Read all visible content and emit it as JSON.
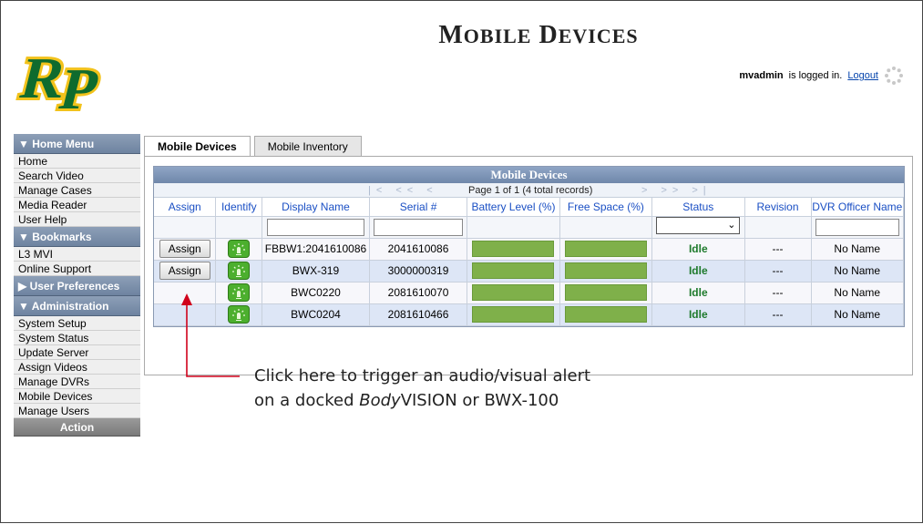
{
  "header": {
    "title_first": "M",
    "title_first_rest": "OBILE",
    "title_second": "D",
    "title_second_rest": "EVICES",
    "user": "mvadmin",
    "logged_in_text": "is logged in.",
    "logout_label": "Logout"
  },
  "sidebar": {
    "sections": [
      {
        "header": "▼ Home Menu",
        "items": [
          "Home",
          "Search Video",
          "Manage Cases",
          "Media Reader",
          "User Help"
        ]
      },
      {
        "header": "▼ Bookmarks",
        "items": [
          "L3 MVI",
          "Online Support"
        ]
      },
      {
        "header": "▶ User Preferences",
        "items": []
      },
      {
        "header": "▼ Administration",
        "items": [
          "System Setup",
          "System Status",
          "Update Server",
          "Assign Videos",
          "Manage DVRs",
          "Mobile Devices",
          "Manage Users"
        ]
      }
    ],
    "action_label": "Action"
  },
  "tabs": [
    {
      "label": "Mobile Devices",
      "active": true
    },
    {
      "label": "Mobile Inventory",
      "active": false
    }
  ],
  "grid": {
    "title": "Mobile Devices",
    "pager_info": "Page 1 of 1 (4 total records)",
    "nav_left": "|< << <",
    "nav_right": "> >> >|",
    "columns": [
      "Assign",
      "Identify",
      "Display Name",
      "Serial #",
      "Battery Level (%)",
      "Free Space (%)",
      "Status",
      "Revision",
      "DVR Officer Name"
    ],
    "rows": [
      {
        "assign": "Assign",
        "display_name": "FBBW1:2041610086",
        "serial": "2041610086",
        "battery": 100,
        "free_space": 100,
        "status": "Idle",
        "revision": "---",
        "officer": "No Name"
      },
      {
        "assign": "Assign",
        "display_name": "BWX-319",
        "serial": "3000000319",
        "battery": 100,
        "free_space": 100,
        "status": "Idle",
        "revision": "---",
        "officer": "No Name"
      },
      {
        "assign": "",
        "display_name": "BWC0220",
        "serial": "2081610070",
        "battery": 100,
        "free_space": 100,
        "status": "Idle",
        "revision": "---",
        "officer": "No Name"
      },
      {
        "assign": "",
        "display_name": "BWC0204",
        "serial": "2081610466",
        "battery": 100,
        "free_space": 100,
        "status": "Idle",
        "revision": "---",
        "officer": "No Name"
      }
    ],
    "status_filter_glyph": "⌄"
  },
  "callout": {
    "line1": "Click here to trigger an audio/visual alert",
    "line2_prefix": "on a docked ",
    "line2_italic": "Body",
    "line2_suffix": "VISION or BWX-100"
  },
  "colors": {
    "header_blue": "#6f87aa",
    "status_green": "#1e7a2c",
    "bar_green": "#7fb04a",
    "arrow_red": "#d0021b"
  },
  "icons": {
    "logo": "rp-logo",
    "spinner": "loading-spinner-icon",
    "identify": "alert-light-icon"
  }
}
